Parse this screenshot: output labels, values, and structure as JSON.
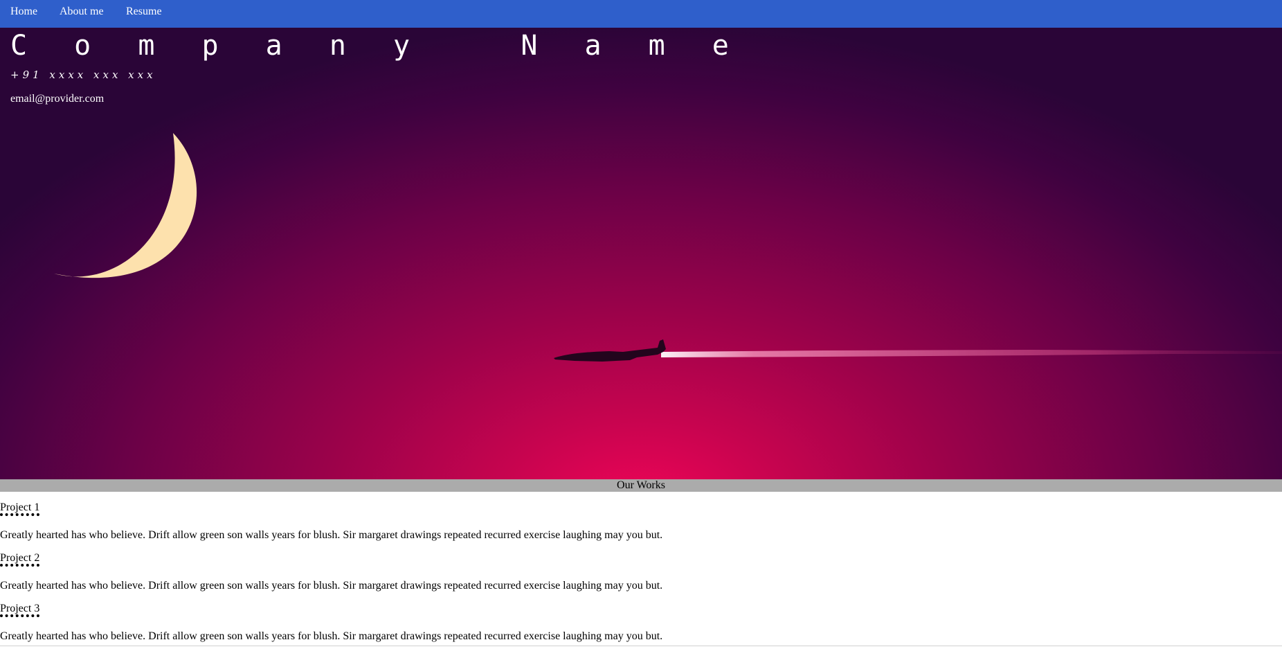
{
  "nav": {
    "items": [
      {
        "label": "Home"
      },
      {
        "label": "About me"
      },
      {
        "label": "Resume"
      }
    ]
  },
  "hero": {
    "company": "C o m p a n y   N a m e",
    "phone": "+91 xxxx xxx xxx",
    "email": "email@provider.com",
    "colors": {
      "center": "#ee0557",
      "edge": "#2a0537",
      "moon": "#fde1ad"
    }
  },
  "works": {
    "title": "Our Works",
    "projects": [
      {
        "title": "Project 1",
        "description": "Greatly hearted has who believe. Drift allow green son walls years for blush. Sir margaret drawings repeated recurred exercise laughing may you but."
      },
      {
        "title": "Project 2",
        "description": "Greatly hearted has who believe. Drift allow green son walls years for blush. Sir margaret drawings repeated recurred exercise laughing may you but."
      },
      {
        "title": "Project 3",
        "description": "Greatly hearted has who believe. Drift allow green son walls years for blush. Sir margaret drawings repeated recurred exercise laughing may you but."
      }
    ]
  },
  "nav_color": "#2f5fcb"
}
